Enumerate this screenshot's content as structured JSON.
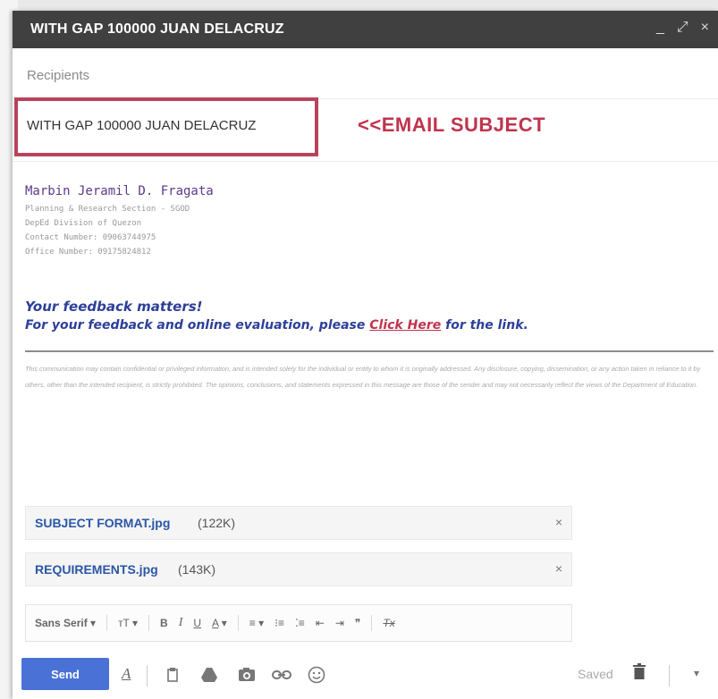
{
  "window": {
    "title": "WITH GAP 100000 JUAN DELACRUZ",
    "minimize_glyph": "_",
    "expand_glyph": "⤢",
    "close_glyph": "×"
  },
  "recipients": {
    "placeholder": "Recipients"
  },
  "subject": {
    "value": "WITH GAP 100000 JUAN DELACRUZ"
  },
  "annotation": {
    "text": "<<EMAIL SUBJECT"
  },
  "signature": {
    "name": "Marbin Jeramil D. Fragata",
    "lines": [
      "Planning & Research Section - SGOD",
      "DepEd Division of Quezon",
      "Contact Number: 09063744975",
      "Office Number: 09175824812"
    ]
  },
  "feedback": {
    "line1": "Your feedback matters!",
    "line2_prefix": "For your feedback and online evaluation, please",
    "link_text": "Click Here",
    "line2_suffix": "for the link."
  },
  "disclaimer": "This communication may contain confidential or privileged information, and is intended solely for the individual or entity to whom it is originally addressed. Any disclosure, copying, dissemination, or any action taken in reliance to it by others, other than the intended recipient, is strictly prohibited. The opinions, conclusions, and statements expressed in this message are those of the sender and may not necessarily reflect the views of the Department of Education.",
  "attachments": [
    {
      "name": "SUBJECT FORMAT.jpg",
      "size": "(122K)"
    },
    {
      "name": "REQUIREMENTS.jpg",
      "size": "(143K)"
    }
  ],
  "attachment_remove_glyph": "×",
  "format_toolbar": {
    "font": "Sans Serif",
    "size_glyph": "тT",
    "bold": "B",
    "italic": "I",
    "underline": "U",
    "text_color": "A",
    "align": "≡",
    "numbered_list": "⁝≡",
    "bulleted_list": "⁚≡",
    "indent_less": "⇤",
    "indent_more": "⇥",
    "quote": "❞",
    "clear_format": "Tx"
  },
  "bottom_bar": {
    "send_label": "Send",
    "formatting_glyph": "A",
    "saved_label": "Saved"
  },
  "colors": {
    "titlebar": "#404040",
    "annotation": "#c0344d",
    "link": "#c0344d",
    "feedback": "#2d3f9a",
    "send": "#4a72d6"
  }
}
